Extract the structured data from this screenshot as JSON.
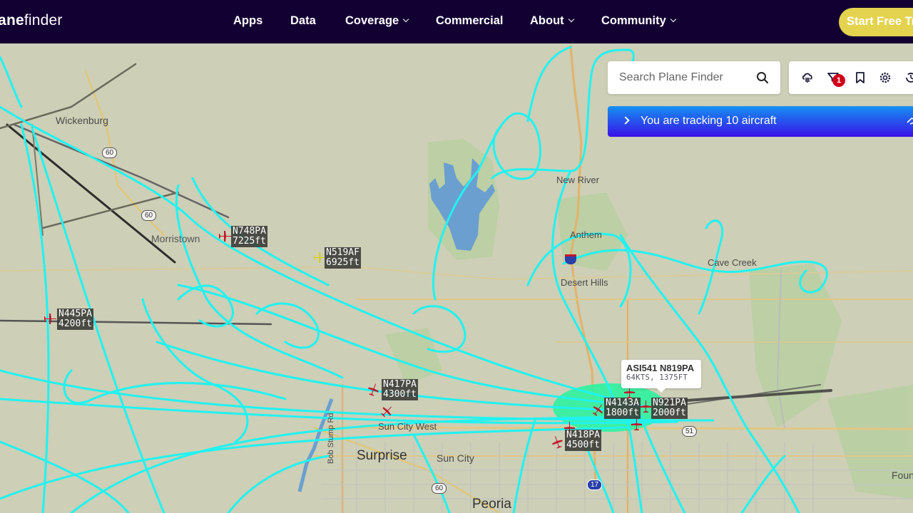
{
  "header": {
    "logo_bold": "ne",
    "logo_prefix": "pla",
    "logo_rest": "finder",
    "nav": [
      {
        "label": "Apps",
        "dropdown": false
      },
      {
        "label": "Data",
        "dropdown": false
      },
      {
        "label": "Coverage",
        "dropdown": true
      },
      {
        "label": "Commercial",
        "dropdown": false
      },
      {
        "label": "About",
        "dropdown": true
      },
      {
        "label": "Community",
        "dropdown": true
      }
    ],
    "cta_label": "Start Free Trial",
    "colors": {
      "bar": "#130033",
      "cta": "#e4d34f"
    }
  },
  "search": {
    "placeholder": "Search Plane Finder",
    "value": ""
  },
  "toolbar": {
    "icons": [
      "cloud-weather-icon",
      "filter-icon",
      "bookmark-icon",
      "gear-icon",
      "history-icon"
    ],
    "filter_badge": "1"
  },
  "tracking_banner": {
    "text": "You are tracking 10 aircraft",
    "count": 10
  },
  "tooltip": {
    "title": "ASI541 N819PA",
    "detail": "64KTS, 1375FT"
  },
  "aircraft": [
    {
      "reg": "N748PA",
      "alt": "7225ft",
      "color": "#c0182c"
    },
    {
      "reg": "N519AF",
      "alt": "6925ft",
      "color": "#d8cc2a"
    },
    {
      "reg": "N445PA",
      "alt": "4200ft",
      "color": "#c0182c"
    },
    {
      "reg": "N417PA",
      "alt": "4300ft",
      "color": "#c0182c"
    },
    {
      "reg": "N4143A",
      "alt": "1800ft",
      "color": "#c0182c"
    },
    {
      "reg": "N921PA",
      "alt": "2000ft",
      "color": "#c0182c"
    },
    {
      "reg": "N418PA",
      "alt": "4500ft",
      "color": "#c0182c"
    }
  ],
  "places": [
    {
      "name": "Wickenburg"
    },
    {
      "name": "Morristown"
    },
    {
      "name": "New River"
    },
    {
      "name": "Anthem"
    },
    {
      "name": "Desert Hills"
    },
    {
      "name": "Cave Creek"
    },
    {
      "name": "Sun City West"
    },
    {
      "name": "Surprise"
    },
    {
      "name": "Sun City"
    },
    {
      "name": "Peoria"
    },
    {
      "name": "Fountain Hills"
    },
    {
      "name": "Bob Stump Rd"
    }
  ],
  "highways": [
    "60",
    "60",
    "60",
    "17",
    "51"
  ],
  "map_colors": {
    "land": "#cdcfb7",
    "park": "#b7cfa0",
    "water": "#6a9fcf",
    "track": "#21f2f0",
    "track_green": "#2ff2a0"
  }
}
